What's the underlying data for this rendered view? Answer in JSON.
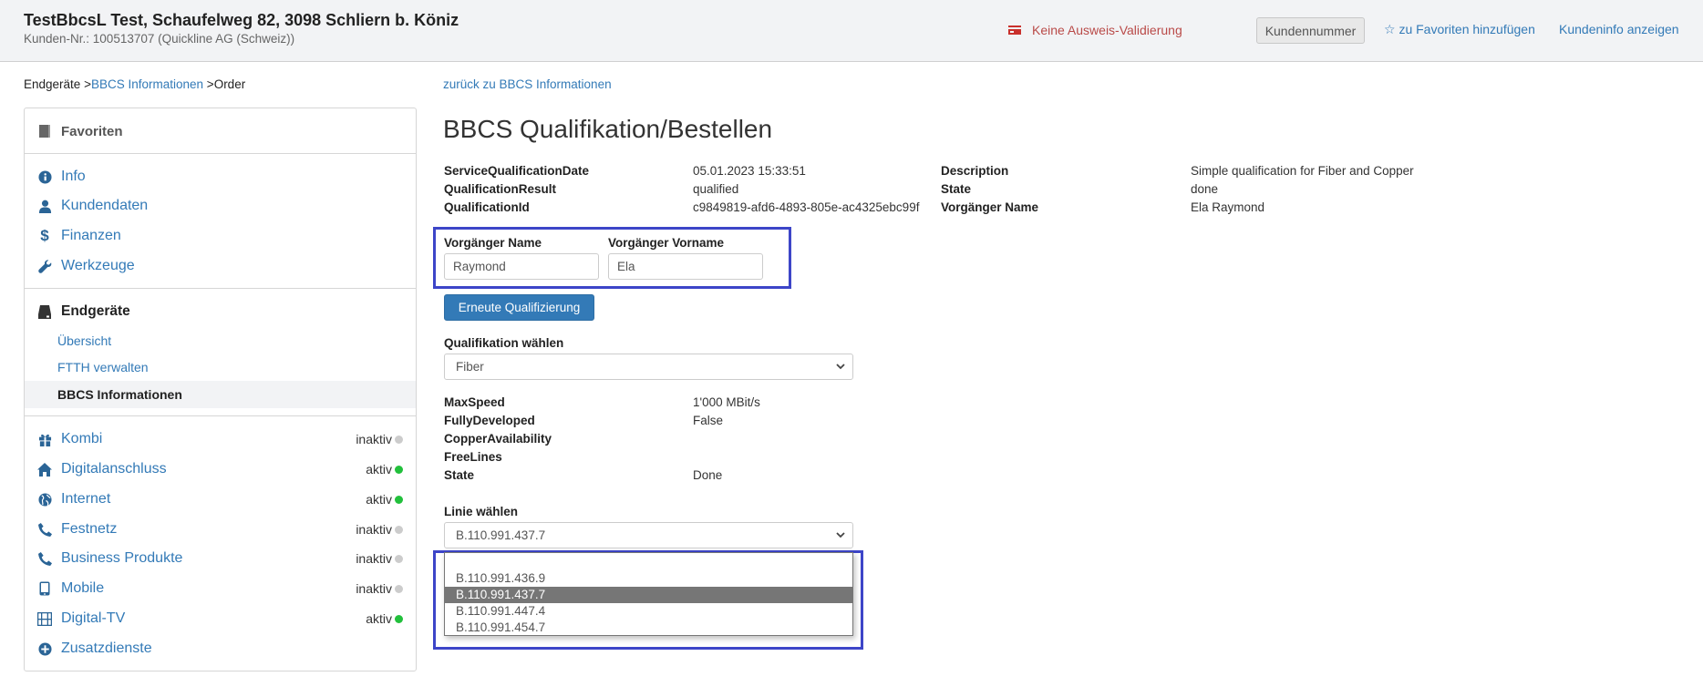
{
  "header": {
    "customer_title": "TestBbcsL Test, Schaufelweg 82, 3098 Schliern b. Köniz",
    "customer_subtitle": "Kunden-Nr.: 100513707 (Quickline AG (Schweiz))",
    "id_warning": "Keine Ausweis-Validierung",
    "customer_number_button": "Kundennummer",
    "add_favorite": "zu Favoriten hinzufügen",
    "show_customer_info": "Kundeninfo anzeigen",
    "colors": {
      "warning": "#b94a48",
      "link": "#337ab7"
    }
  },
  "breadcrumb": {
    "items": [
      "Endgeräte",
      "BBCS Informationen",
      "Order"
    ],
    "separator": ">"
  },
  "sidebar": {
    "favorites": "Favoriten",
    "general": [
      {
        "label": "Info",
        "icon": "info-circle-icon"
      },
      {
        "label": "Kundendaten",
        "icon": "user-icon"
      },
      {
        "label": "Finanzen",
        "icon": "dollar-icon"
      },
      {
        "label": "Werkzeuge",
        "icon": "wrench-icon"
      }
    ],
    "section": {
      "label": "Endgeräte",
      "icon": "hdd-icon"
    },
    "sub_items": [
      {
        "label": "Übersicht",
        "active": false
      },
      {
        "label": "FTTH verwalten",
        "active": false
      },
      {
        "label": "BBCS Informationen",
        "active": true
      }
    ],
    "products": [
      {
        "label": "Kombi",
        "icon": "gift-icon",
        "status": "inaktiv",
        "status_color": "#cccccc"
      },
      {
        "label": "Digitalanschluss",
        "icon": "home-icon",
        "status": "aktiv",
        "status_color": "#22c03c"
      },
      {
        "label": "Internet",
        "icon": "globe-icon",
        "status": "aktiv",
        "status_color": "#22c03c"
      },
      {
        "label": "Festnetz",
        "icon": "phone-icon",
        "status": "inaktiv",
        "status_color": "#cccccc"
      },
      {
        "label": "Business Produkte",
        "icon": "phone-icon",
        "status": "inaktiv",
        "status_color": "#cccccc"
      },
      {
        "label": "Mobile",
        "icon": "mobile-icon",
        "status": "inaktiv",
        "status_color": "#cccccc"
      },
      {
        "label": "Digital-TV",
        "icon": "film-icon",
        "status": "aktiv",
        "status_color": "#22c03c"
      },
      {
        "label": "Zusatzdienste",
        "icon": "plus-circle-icon",
        "status": null,
        "status_color": null
      }
    ]
  },
  "main": {
    "back_link": "zurück zu BBCS Informationen",
    "title": "BBCS Qualifikation/Bestellen",
    "qualification_left": [
      {
        "key": "ServiceQualificationDate",
        "value": "05.01.2023 15:33:51"
      },
      {
        "key": "QualificationResult",
        "value": "qualified"
      },
      {
        "key": "QualificationId",
        "value": "c9849819-afd6-4893-805e-ac4325ebc99f"
      }
    ],
    "qualification_right": [
      {
        "key": "Description",
        "value": "Simple qualification for Fiber and Copper"
      },
      {
        "key": "State",
        "value": "done"
      },
      {
        "key": "Vorgänger Name",
        "value": "Ela Raymond"
      }
    ],
    "predecessor": {
      "name_label": "Vorgänger Name",
      "name_value": "Raymond",
      "firstname_label": "Vorgänger Vorname",
      "firstname_value": "Ela"
    },
    "requalify_button": "Erneute Qualifizierung",
    "qualification_select": {
      "label": "Qualifikation wählen",
      "value": "Fiber"
    },
    "line_details": [
      {
        "key": "MaxSpeed",
        "value": "1'000 MBit/s"
      },
      {
        "key": "FullyDeveloped",
        "value": "False"
      },
      {
        "key": "CopperAvailability",
        "value": ""
      },
      {
        "key": "FreeLines",
        "value": ""
      },
      {
        "key": "State",
        "value": "Done"
      }
    ],
    "line_select": {
      "label": "Linie wählen",
      "value": "B.110.991.437.7",
      "options": [
        "",
        "B.110.991.436.9",
        "B.110.991.437.7",
        "B.110.991.447.4",
        "B.110.991.454.7"
      ],
      "selected_index": 2
    },
    "annotation_color": "#3d45c8"
  }
}
